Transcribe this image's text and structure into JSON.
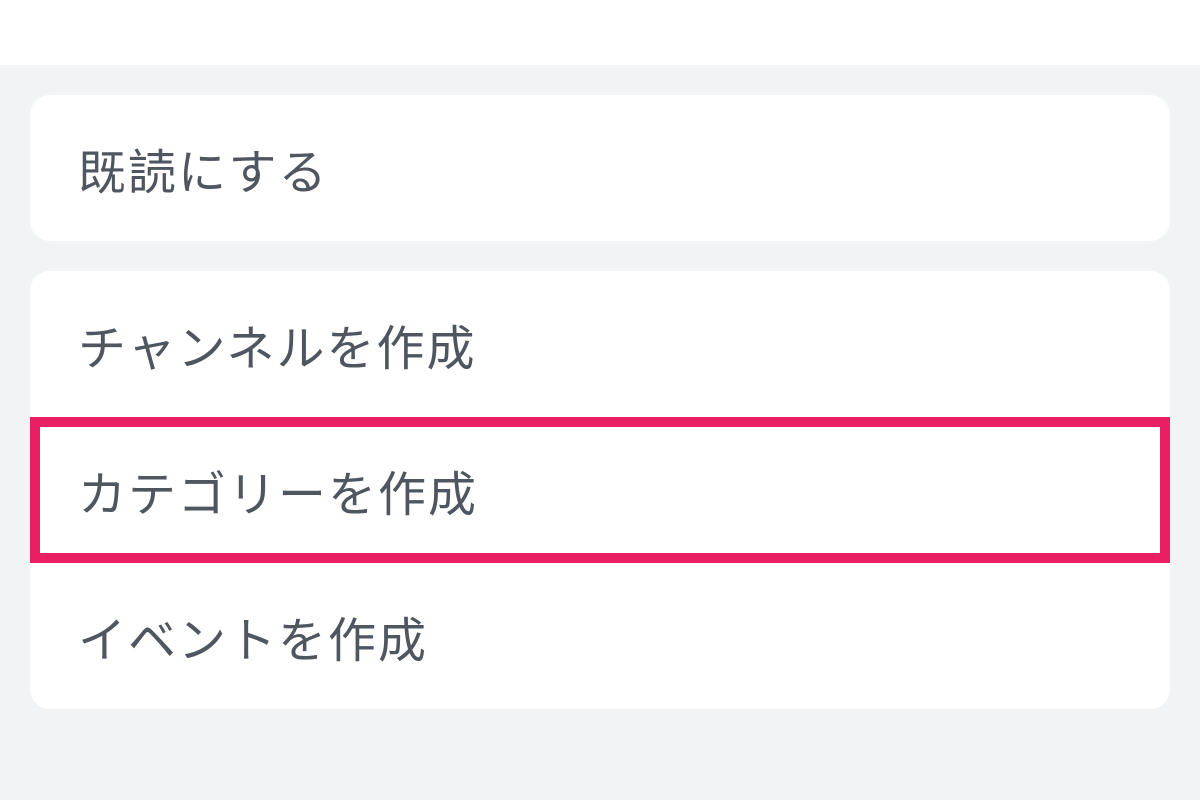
{
  "menu": {
    "group1": {
      "items": [
        {
          "label": "既読にする"
        }
      ]
    },
    "group2": {
      "items": [
        {
          "label": "チャンネルを作成"
        },
        {
          "label": "カテゴリーを作成"
        },
        {
          "label": "イベントを作成"
        }
      ]
    }
  },
  "highlight_color": "#e91e63"
}
